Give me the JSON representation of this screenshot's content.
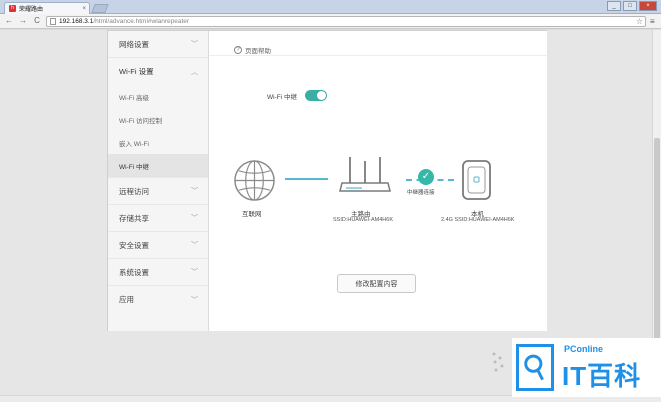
{
  "browser": {
    "tab_title": "荣耀路由",
    "url_host": "192.168.3.1",
    "url_path": "/html/advance.html#wlanrepeater",
    "tab_close": "×",
    "back": "←",
    "forward": "→",
    "reload": "C",
    "star": "☆",
    "menu": "≡",
    "win_min": "_",
    "win_max": "□",
    "win_close": "×"
  },
  "sidebar": {
    "network_settings": "网络设置",
    "wifi_settings": "Wi-Fi 设置",
    "sub_items": [
      {
        "label": "Wi-Fi 高级",
        "active": false
      },
      {
        "label": "Wi-Fi 访问控制",
        "active": false
      },
      {
        "label": "嵌入 Wi-Fi",
        "active": false
      },
      {
        "label": "Wi-Fi 中继",
        "active": true
      }
    ],
    "items": [
      {
        "label": "远程访问"
      },
      {
        "label": "存储共享"
      },
      {
        "label": "安全设置"
      },
      {
        "label": "系统设置"
      },
      {
        "label": "应用"
      }
    ],
    "chev_down": "﹀",
    "chev_up": "︿"
  },
  "main": {
    "help_label": "页面帮助",
    "help_icon": "?",
    "relay_label": "Wi-Fi 中继",
    "relay_enabled": true,
    "internet_label": "互联网",
    "router_label": "主路由",
    "router_ssid": "SSID:HUAWEI-AM4H6K",
    "relay_status": "中继器连接",
    "check_mark": "✓",
    "device_label": "本机",
    "device_ssid": "2.4G SSID:HUAWEI-AM4H6K",
    "modify_button": "修改配置内容"
  },
  "watermark": {
    "brand": "PConline",
    "name": "IT百科"
  },
  "colors": {
    "accent": "#3aaea6",
    "line": "#5ab7d2",
    "watermark": "#1e90e8"
  }
}
